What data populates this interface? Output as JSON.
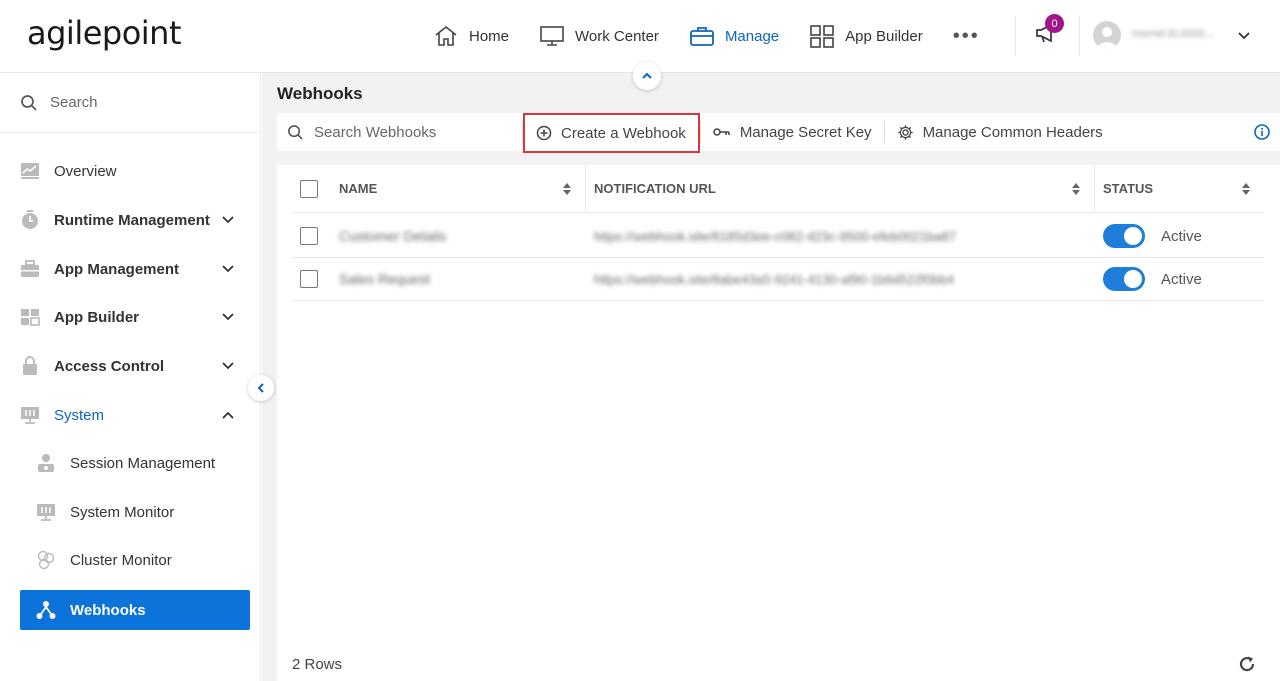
{
  "brand": {
    "logo_text": "agilepoint"
  },
  "nav": {
    "items": [
      {
        "label": "Home",
        "icon": "home-icon"
      },
      {
        "label": "Work Center",
        "icon": "monitor-icon"
      },
      {
        "label": "Manage",
        "icon": "briefcase-icon",
        "active": true
      },
      {
        "label": "App Builder",
        "icon": "grid-icon"
      }
    ],
    "more_label": "•••",
    "notification_count": "0",
    "username": "rosmel.t0.0000..."
  },
  "sidebar": {
    "search_label": "Search",
    "items": [
      {
        "label": "Overview"
      },
      {
        "label": "Runtime Management"
      },
      {
        "label": "App Management"
      },
      {
        "label": "App Builder"
      },
      {
        "label": "Access Control"
      },
      {
        "label": "System"
      },
      {
        "label": "Session Management"
      },
      {
        "label": "System Monitor"
      },
      {
        "label": "Cluster Monitor"
      },
      {
        "label": "Webhooks"
      }
    ]
  },
  "page": {
    "title": "Webhooks",
    "toolbar": {
      "search_placeholder": "Search Webhooks",
      "create_label": "Create a Webhook",
      "secret_label": "Manage Secret Key",
      "headers_label": "Manage Common Headers"
    },
    "table": {
      "columns": [
        "NAME",
        "NOTIFICATION URL",
        "STATUS"
      ],
      "rows": [
        {
          "name": "Customer Details",
          "url": "https://webhook.site/8185d3ee-c082-423c-9500-efeb0021ba87",
          "status": "Active"
        },
        {
          "name": "Sales Request",
          "url": "https://webhook.site/8abe43a5-9241-4130-af90-1b6d522f0bb4",
          "status": "Active"
        }
      ]
    },
    "footer": {
      "rows_label": "2 Rows"
    }
  },
  "colors": {
    "accent": "#0b66c3",
    "selected": "#0b73d9",
    "highlight_border": "#d9383a",
    "badge": "#a0148c"
  }
}
